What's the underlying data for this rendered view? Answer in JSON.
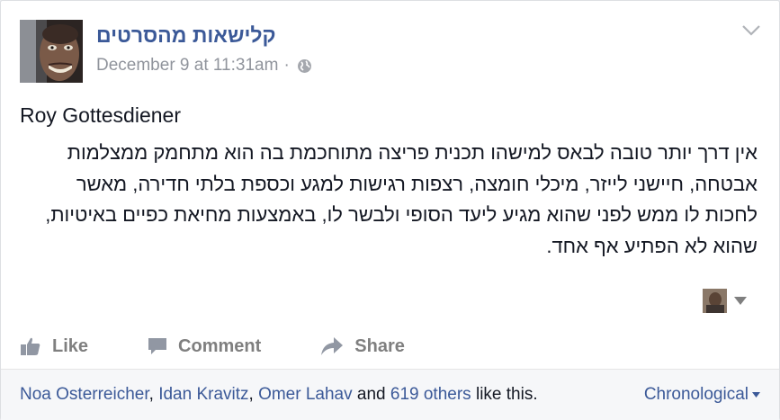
{
  "post": {
    "page_name": "קלישאות מהסרטים",
    "timestamp": "December 9 at 11:31am",
    "separator": "·",
    "privacy_icon": "globe-icon",
    "author": "Roy Gottesdiener",
    "body_lines": [
      "אין דרך יותר טובה לבאס למישהו תכנית פריצה מתוחכמת בה הוא מתחמק ממצלמות",
      "אבטחה, חיישני לייזר, מיכלי חומצה, רצפות רגישות למגע וכספת בלתי חדירה, מאשר",
      "לחכות לו ממש לפני שהוא מגיע ליעד הסופי ולבשר לו, באמצעות מחיאת כפיים באיטיות,",
      "שהוא לא הפתיע אף אחד."
    ]
  },
  "actions": {
    "like": "Like",
    "comment": "Comment",
    "share": "Share"
  },
  "footer": {
    "likers": [
      "Noa Osterreicher",
      "Idan Kravitz",
      "Omer Lahav"
    ],
    "comma": ",",
    "and_text": "and",
    "others_count": "619 others",
    "like_this": "like this.",
    "sort_label": "Chronological"
  },
  "colors": {
    "link": "#3b5998",
    "muted": "#90949c",
    "action": "#7f7f7f"
  }
}
